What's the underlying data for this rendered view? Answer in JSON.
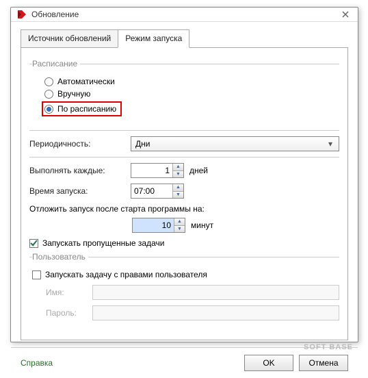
{
  "window": {
    "title": "Обновление"
  },
  "tabs": {
    "source": "Источник обновлений",
    "mode": "Режим запуска"
  },
  "schedule": {
    "legend": "Расписание",
    "auto": "Автоматически",
    "manual": "Вручную",
    "by_schedule": "По расписанию"
  },
  "periodicity": {
    "label": "Периодичность:",
    "value": "Дни"
  },
  "every": {
    "label": "Выполнять каждые:",
    "value": "1",
    "unit": "дней"
  },
  "start_time": {
    "label": "Время запуска:",
    "value": "07:00"
  },
  "postpone": {
    "label": "Отложить запуск после старта программы на:",
    "value": "10",
    "unit": "минут"
  },
  "run_missed": {
    "label": "Запускать пропущенные задачи"
  },
  "user": {
    "legend": "Пользователь",
    "run_as": "Запускать задачу с правами пользователя",
    "name_label": "Имя:",
    "password_label": "Пароль:"
  },
  "footer": {
    "help": "Справка",
    "ok": "OK",
    "cancel": "Отмена"
  },
  "watermark": "SOFT BASE"
}
